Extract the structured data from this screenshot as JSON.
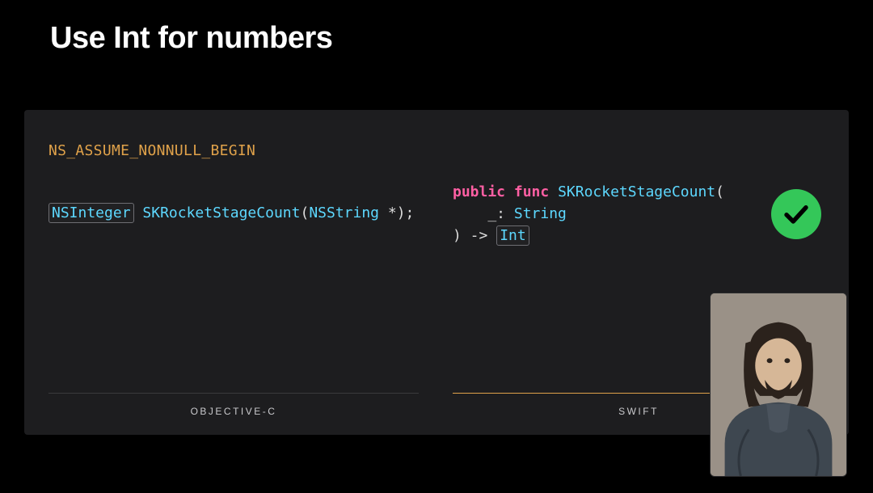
{
  "title": "Use Int for numbers",
  "macro": "NS_ASSUME_NONNULL_BEGIN",
  "objc": {
    "type_boxed": "NSInteger",
    "line_rest": " SKRocketStageCount(NSString *);",
    "func_name": "SKRocketStageCount",
    "sig_open": "(",
    "param_type": "NSString",
    "sig_rest": " *);",
    "label": "OBJECTIVE-C"
  },
  "swift": {
    "kw_public": "public",
    "kw_func": "func",
    "func_name": "SKRocketStageCount",
    "open_paren": "(",
    "param_line": "    _: String",
    "param_prefix": "    _: ",
    "param_type": "String",
    "close_arrow": ") -> ",
    "return_type_boxed": "Int",
    "label": "SWIFT"
  },
  "status": {
    "ok": true
  }
}
